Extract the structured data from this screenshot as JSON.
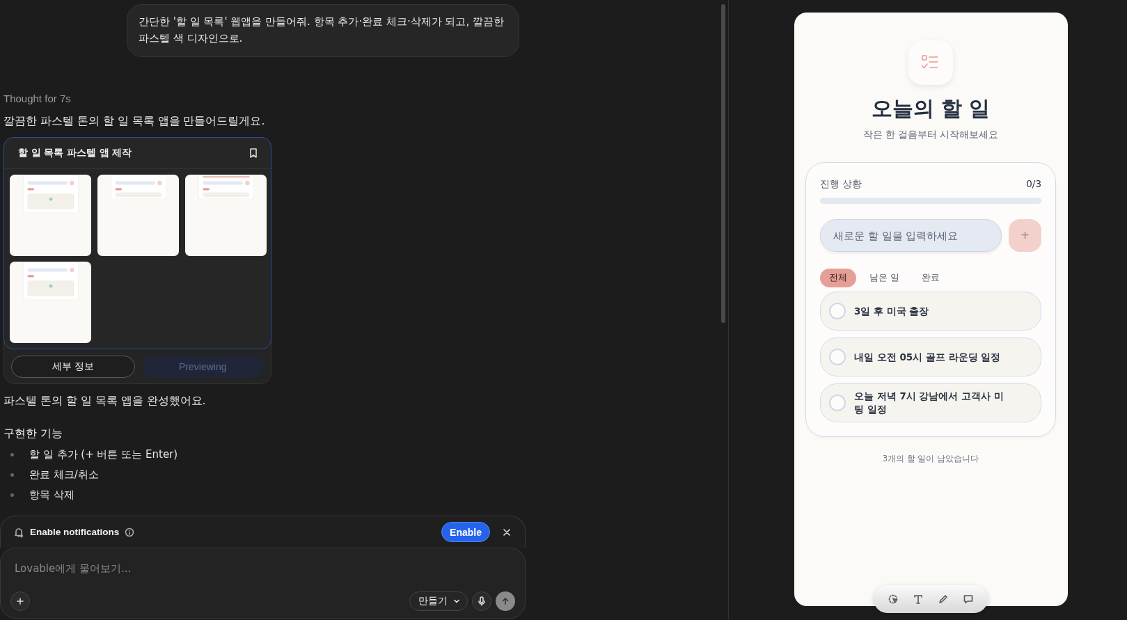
{
  "chat": {
    "user_message": "간단한 '할 일 목록' 웹앱을 만들어줘. 항목 추가·완료 체크·삭제가 되고, 깔끔한 파스텔 색 디자인으로.",
    "thought": "Thought for 7s",
    "intro": "깔끔한 파스텔 톤의 할 일 목록 앱을 만들어드릴게요.",
    "artifact": {
      "title": "할 일 목록 파스텔 앱 제작",
      "thumbnails": [
        {
          "kind": "empty"
        },
        {
          "kind": "list"
        },
        {
          "kind": "progress"
        },
        {
          "kind": "empty"
        }
      ],
      "buttons": [
        {
          "label": "세부 정보",
          "kind": "outline"
        },
        {
          "label": "Previewing",
          "kind": "active"
        }
      ]
    },
    "summary": "파스텔 톤의 할 일 목록 앱을 완성했어요.",
    "features_heading": "구현한 기능",
    "features": [
      "할 일 추가 (+ 버튼 또는 Enter)",
      "완료 체크/취소",
      "항목 삭제"
    ]
  },
  "notification": {
    "label": "Enable notifications",
    "button": "Enable"
  },
  "composer": {
    "placeholder": "Lovable에게 물어보기...",
    "mode": "만들기"
  },
  "preview": {
    "title": "오늘의 할 일",
    "subtitle": "작은 한 걸음부터 시작해보세요",
    "progress": {
      "label": "진행 상황",
      "count": "0/3",
      "level": 0
    },
    "input": {
      "placeholder": "새로운 할 일을 입력하세요"
    },
    "add_button": "+",
    "filters": [
      {
        "label": "전체",
        "selected": true
      },
      {
        "label": "남은 일",
        "selected": false
      },
      {
        "label": "완료",
        "selected": false
      }
    ],
    "todos": [
      {
        "text": "3일 후 미국 출장",
        "checked": false
      },
      {
        "text": "내일 오전 05시 골프 라운딩 일정",
        "checked": false
      },
      {
        "text": "오늘 저녁 7시 강남에서 고객사 미팅 일정",
        "checked": false
      }
    ],
    "footer": "3개의 할 일이 남았습니다"
  }
}
